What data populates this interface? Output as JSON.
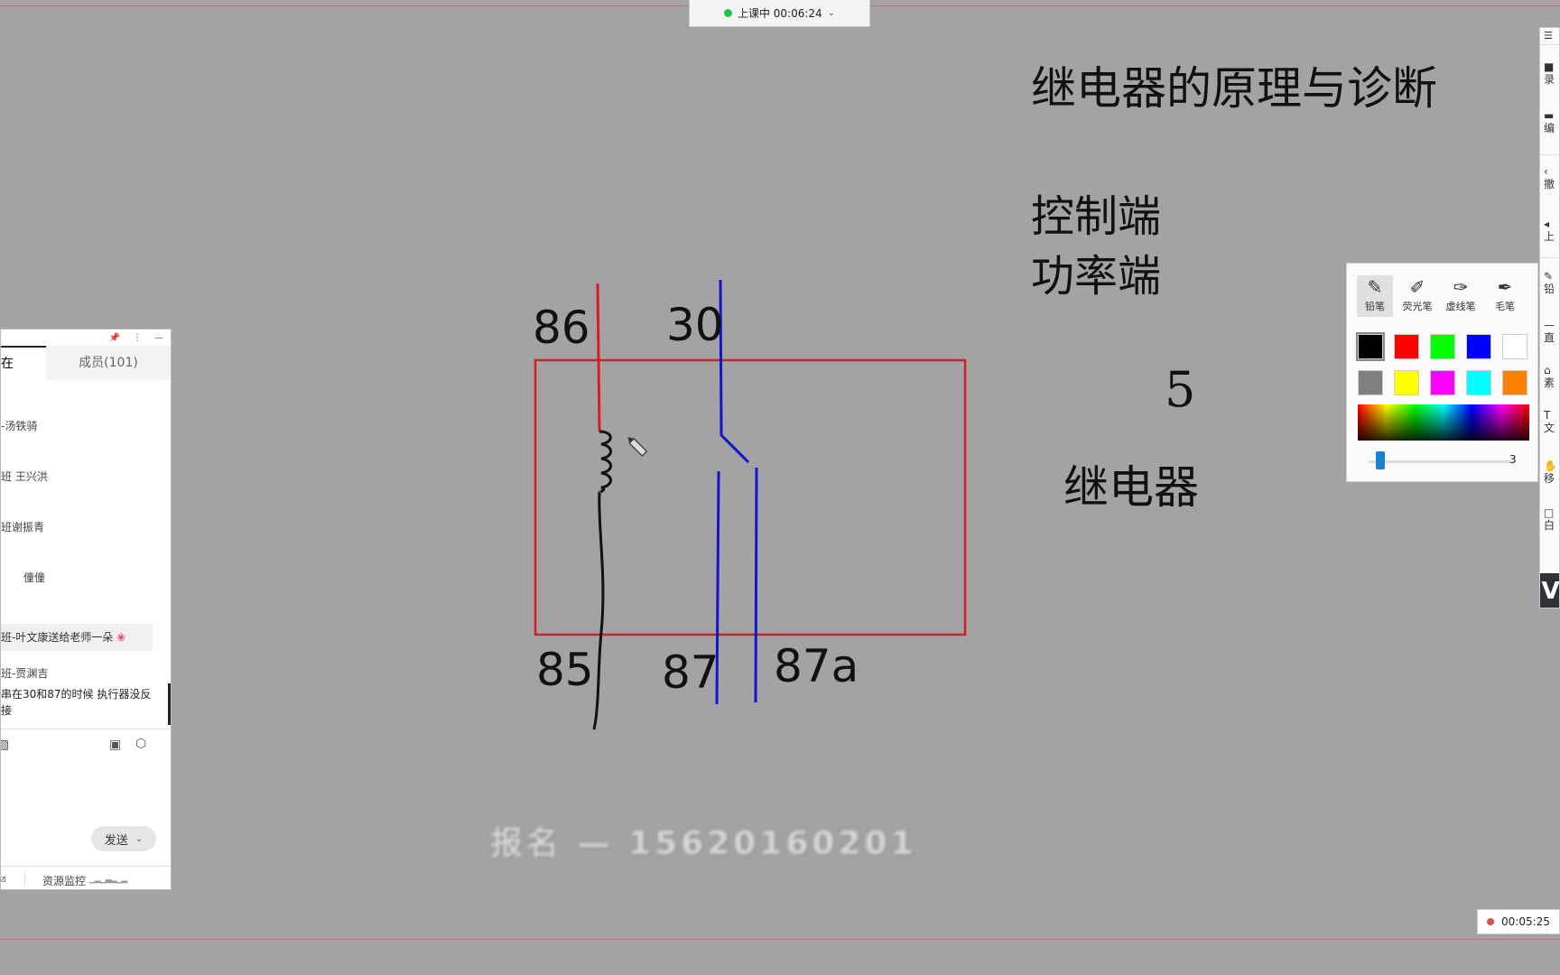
{
  "top_status": {
    "label": "上课中 00:06:24"
  },
  "board": {
    "title": "继电器的原理与诊断",
    "control_end": "控制端",
    "power_end": "功率端",
    "handwritten_number": "5",
    "relay_label": "继电器",
    "pins": {
      "p86": "86",
      "p30": "30",
      "p85": "85",
      "p87": "87",
      "p87a": "87a"
    },
    "watermark": "报名 — 15620160201"
  },
  "chat": {
    "tab_active": "在",
    "tab_members": "成员(101)",
    "messages": [
      "-汤铁骑",
      "班 王兴洪",
      "班谢振青",
      "僮僮",
      "班-叶文康送给老师一朵",
      "班-贾渊吉",
      "串在30和87的时候 执行器没反",
      "接"
    ],
    "send_button": "发送",
    "resource_monitor": "资源监控"
  },
  "palette": {
    "pens": [
      "铅笔",
      "荧光笔",
      "虚线笔",
      "毛笔"
    ],
    "colors": [
      "#000000",
      "#ff0000",
      "#00ff00",
      "#0000ff",
      "#ffffff",
      "#808080",
      "#ffff00",
      "#ff00ff",
      "#00ffff",
      "#ff8000"
    ],
    "size_value": "3"
  },
  "right_toolbar": {
    "items": [
      "录",
      "编",
      "撤",
      "上",
      "铅",
      "直",
      "素",
      "文",
      "移",
      "白"
    ]
  },
  "record_timer": "00:05:25",
  "colors": {
    "wire_red": "#d81e1e",
    "wire_blue": "#1515c8",
    "board_bg": "#a3a2a5"
  }
}
